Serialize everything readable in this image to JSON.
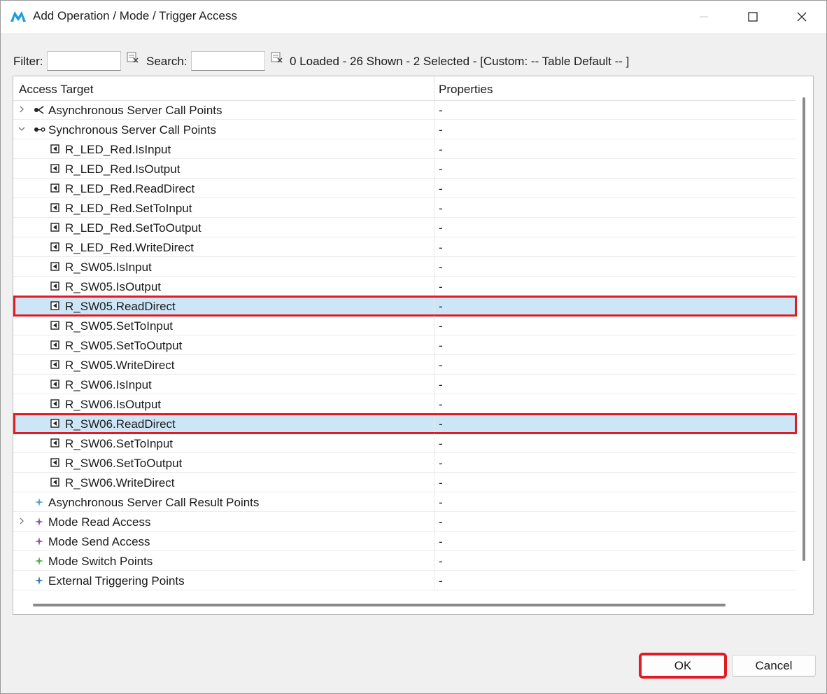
{
  "window": {
    "title": "Add Operation / Mode / Trigger Access"
  },
  "toolbar": {
    "filter_label": "Filter:",
    "filter_value": "",
    "search_label": "Search:",
    "search_value": "",
    "status": "0 Loaded - 26 Shown - 2 Selected -  [Custom: -- Table Default -- ]"
  },
  "table": {
    "columns": [
      "Access Target",
      "Properties"
    ],
    "rows": [
      {
        "label": "Asynchronous Server Call Points",
        "prop": "-",
        "level": 0,
        "expander": "collapsed",
        "icon": "async-server-call-icon",
        "selected": false
      },
      {
        "label": "Synchronous Server Call Points",
        "prop": "-",
        "level": 0,
        "expander": "expanded",
        "icon": "sync-server-call-icon",
        "selected": false
      },
      {
        "label": "R_LED_Red.IsInput",
        "prop": "-",
        "level": 1,
        "expander": "none",
        "icon": "operation-icon",
        "selected": false
      },
      {
        "label": "R_LED_Red.IsOutput",
        "prop": "-",
        "level": 1,
        "expander": "none",
        "icon": "operation-icon",
        "selected": false
      },
      {
        "label": "R_LED_Red.ReadDirect",
        "prop": "-",
        "level": 1,
        "expander": "none",
        "icon": "operation-icon",
        "selected": false
      },
      {
        "label": "R_LED_Red.SetToInput",
        "prop": "-",
        "level": 1,
        "expander": "none",
        "icon": "operation-icon",
        "selected": false
      },
      {
        "label": "R_LED_Red.SetToOutput",
        "prop": "-",
        "level": 1,
        "expander": "none",
        "icon": "operation-icon",
        "selected": false
      },
      {
        "label": "R_LED_Red.WriteDirect",
        "prop": "-",
        "level": 1,
        "expander": "none",
        "icon": "operation-icon",
        "selected": false
      },
      {
        "label": "R_SW05.IsInput",
        "prop": "-",
        "level": 1,
        "expander": "none",
        "icon": "operation-icon",
        "selected": false
      },
      {
        "label": "R_SW05.IsOutput",
        "prop": "-",
        "level": 1,
        "expander": "none",
        "icon": "operation-icon",
        "selected": false
      },
      {
        "label": "R_SW05.ReadDirect",
        "prop": "-",
        "level": 1,
        "expander": "none",
        "icon": "operation-icon",
        "selected": true
      },
      {
        "label": "R_SW05.SetToInput",
        "prop": "-",
        "level": 1,
        "expander": "none",
        "icon": "operation-icon",
        "selected": false
      },
      {
        "label": "R_SW05.SetToOutput",
        "prop": "-",
        "level": 1,
        "expander": "none",
        "icon": "operation-icon",
        "selected": false
      },
      {
        "label": "R_SW05.WriteDirect",
        "prop": "-",
        "level": 1,
        "expander": "none",
        "icon": "operation-icon",
        "selected": false
      },
      {
        "label": "R_SW06.IsInput",
        "prop": "-",
        "level": 1,
        "expander": "none",
        "icon": "operation-icon",
        "selected": false
      },
      {
        "label": "R_SW06.IsOutput",
        "prop": "-",
        "level": 1,
        "expander": "none",
        "icon": "operation-icon",
        "selected": false
      },
      {
        "label": "R_SW06.ReadDirect",
        "prop": "-",
        "level": 1,
        "expander": "none",
        "icon": "operation-icon",
        "selected": true
      },
      {
        "label": "R_SW06.SetToInput",
        "prop": "-",
        "level": 1,
        "expander": "none",
        "icon": "operation-icon",
        "selected": false
      },
      {
        "label": "R_SW06.SetToOutput",
        "prop": "-",
        "level": 1,
        "expander": "none",
        "icon": "operation-icon",
        "selected": false
      },
      {
        "label": "R_SW06.WriteDirect",
        "prop": "-",
        "level": 1,
        "expander": "none",
        "icon": "operation-icon",
        "selected": false
      },
      {
        "label": "Asynchronous Server Call Result Points",
        "prop": "-",
        "level": 0,
        "expander": "none",
        "icon": "result-point-icon",
        "selected": false
      },
      {
        "label": "Mode Read Access",
        "prop": "-",
        "level": 0,
        "expander": "collapsed",
        "icon": "mode-read-icon",
        "selected": false
      },
      {
        "label": "Mode Send Access",
        "prop": "-",
        "level": 0,
        "expander": "none",
        "icon": "mode-send-icon",
        "selected": false
      },
      {
        "label": "Mode Switch Points",
        "prop": "-",
        "level": 0,
        "expander": "none",
        "icon": "mode-switch-icon",
        "selected": false
      },
      {
        "label": "External Triggering Points",
        "prop": "-",
        "level": 0,
        "expander": "none",
        "icon": "trigger-point-icon",
        "selected": false
      }
    ]
  },
  "buttons": {
    "ok": "OK",
    "cancel": "Cancel"
  },
  "colors": {
    "accent_highlight": "#e01b24",
    "selection": "#cde6f7",
    "result_point_icon": "#5aa0d0",
    "mode_read_icon": "#8a5aa0",
    "mode_send_icon": "#8a5aa0",
    "mode_switch_icon": "#4caf50",
    "trigger_point_icon": "#3a78c0"
  }
}
